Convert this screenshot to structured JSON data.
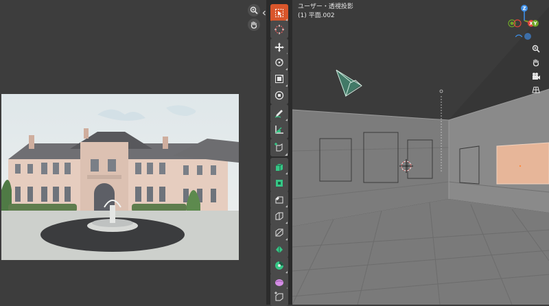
{
  "viewport": {
    "view_name": "ユーザー・透視投影",
    "object_name": "(1) 平面.002",
    "gizmo": {
      "x_label": "X",
      "y_label": "Y",
      "z_label": "Z"
    }
  },
  "left_editor": {
    "controls": [
      "zoom-icon",
      "hand-icon"
    ]
  },
  "toolbar": {
    "tools": [
      "select-box",
      "cursor",
      "move",
      "rotate",
      "scale",
      "transform",
      "annotate",
      "measure",
      "add-cube",
      "extrude-region",
      "inset-faces",
      "bevel",
      "loop-cut",
      "knife",
      "poly-build",
      "spin",
      "smooth",
      "shrink-fatten",
      "shear"
    ],
    "active_tool": "select-box"
  },
  "colors": {
    "accent": "#d9562b",
    "gizmo_x": "#e0453a",
    "gizmo_y": "#6ea528",
    "gizmo_z": "#3d8ee6",
    "tool_green": "#36c786",
    "selection_green": "#4cd9a0"
  }
}
